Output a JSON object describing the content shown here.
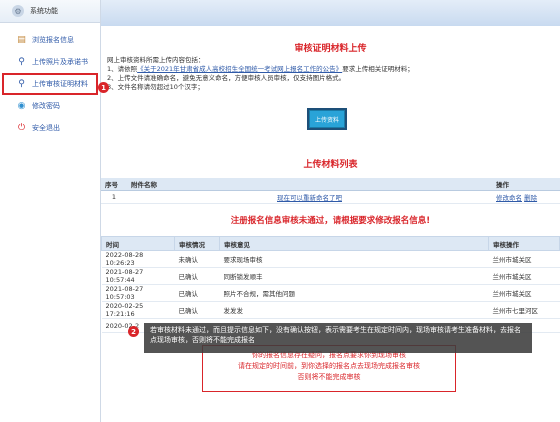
{
  "sidebar": {
    "header": "系统功能",
    "items": [
      {
        "label": "浏览报名信息",
        "icon": "document-icon"
      },
      {
        "label": "上传照片及承诺书",
        "icon": "search-icon"
      },
      {
        "label": "上传审核证明材料",
        "icon": "search-icon"
      },
      {
        "label": "修改密码",
        "icon": "password-icon"
      },
      {
        "label": "安全退出",
        "icon": "logout-icon"
      }
    ],
    "badge": "1"
  },
  "upload_section": {
    "title": "审核证明材料上传",
    "intro": "网上审核资料所需上传内容包括：",
    "line1_prefix": "1、请依照",
    "line1_link": "《关于2021年甘肃省成人高校招生全国统一考试网上报名工作的公告》",
    "line1_suffix": "要求上传相关证明材料；",
    "line2": "2、上传文件请准确命名，避免无意义命名，方便审核人员审核，仅支持图片格式。",
    "line3": "3、文件名称请勿超过10个汉字；",
    "button": "上传资料"
  },
  "files_section": {
    "title": "上传材料列表",
    "columns": [
      "序号",
      "附件名称",
      "操作"
    ],
    "rows": [
      {
        "no": "1",
        "name": "现在可以重新命名了吧",
        "ops": [
          "修改命名",
          "删除"
        ]
      }
    ]
  },
  "notice": "注册报名信息审核未通过，请根据要求修改报名信息!",
  "review_table": {
    "columns": [
      "时间",
      "审核情况",
      "审核意见",
      "审核操作"
    ],
    "rows": [
      {
        "time": "2022-08-28 10:26:23",
        "status": "未确认",
        "opinion": "要求现场审核",
        "operator": "兰州市城关区"
      },
      {
        "time": "2021-08-27 10:57:44",
        "status": "已确认",
        "opinion": "同断锁发顺丰",
        "operator": "兰州市城关区"
      },
      {
        "time": "2021-08-27 10:57:03",
        "status": "已确认",
        "opinion": "照片不合规，需其他问题",
        "operator": "兰州市城关区"
      },
      {
        "time": "2020-02-25 17:21:16",
        "status": "已确认",
        "opinion": "发发发",
        "operator": "兰州市七里河区"
      },
      {
        "time": "2020-02-2",
        "status": "",
        "opinion": "",
        "operator": ""
      }
    ]
  },
  "callout": {
    "badge": "2",
    "text": "若审核材料未通过，而且提示信息如下，没有确认按钮，表示需要考生在规定时间内，现场审核请考生准备材料，去报名点现场审核，否则将不能完成报名"
  },
  "warning_box": {
    "line1": "你的报名信息存在疑问，报名点要求你到现场审核",
    "line2": "请在规定的时间前，到你选择的报名点去现场完成报名审核",
    "line3": "否则将不能完成审核"
  },
  "colors": {
    "accent_red": "#d9252a",
    "link_blue": "#2f5aa8",
    "button_blue": "#29a3d8",
    "header_blue": "#dde8f4"
  }
}
